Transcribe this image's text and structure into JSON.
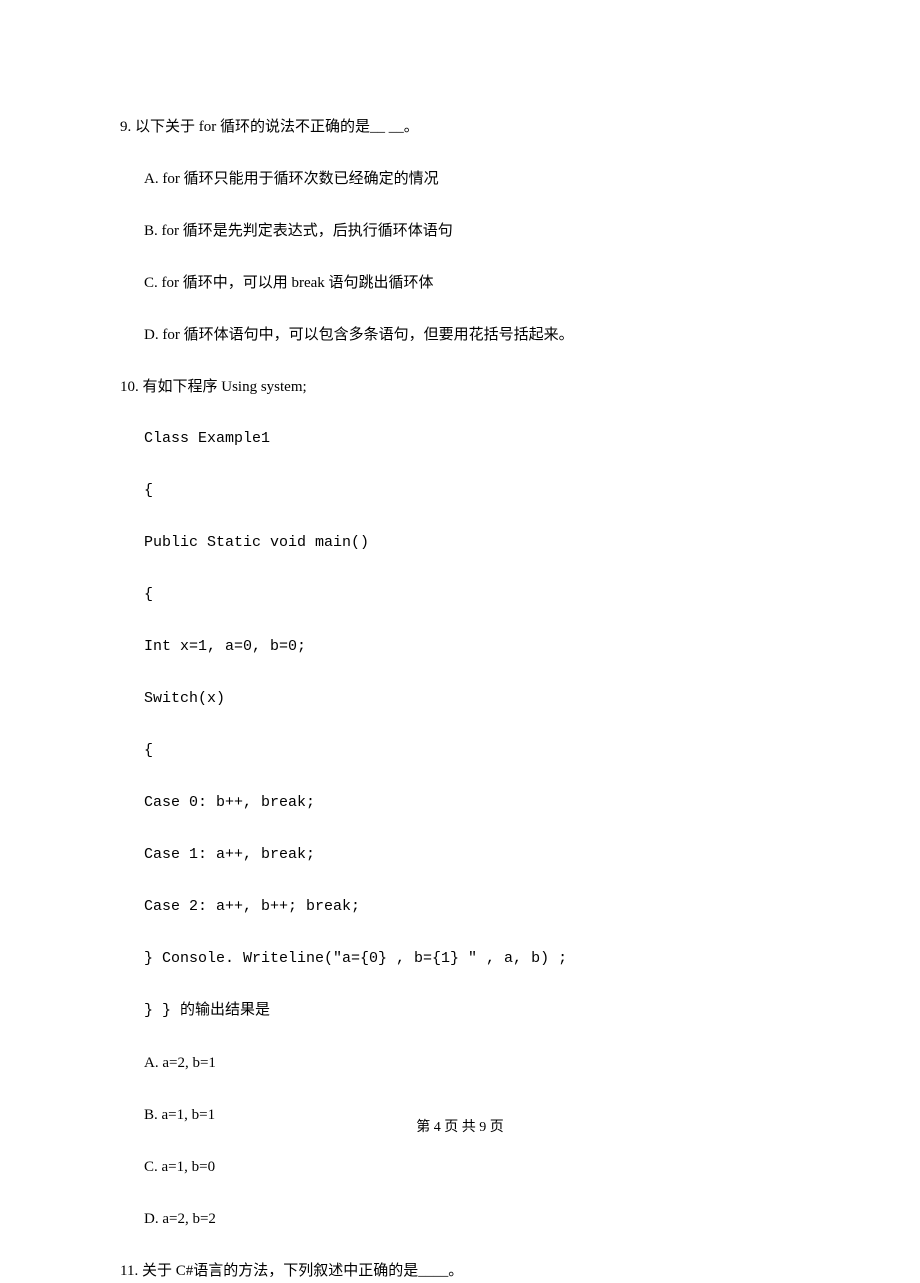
{
  "q9": {
    "stem": "9. 以下关于 for 循环的说法不正确的是__ __。",
    "options": {
      "a": "A. for 循环只能用于循环次数已经确定的情况",
      "b": "B. for 循环是先判定表达式，后执行循环体语句",
      "c": "C. for 循环中，可以用 break 语句跳出循环体",
      "d": "D. for 循环体语句中，可以包含多条语句，但要用花括号括起来。"
    }
  },
  "q10": {
    "stem": "10. 有如下程序 Using system;",
    "code": {
      "l1": "Class Example1",
      "l2": "{",
      "l3": "Public Static void main()",
      "l4": "{",
      "l5": "Int x=1, a=0, b=0;",
      "l6": "Switch(x)",
      "l7": "{",
      "l8": "Case 0: b++, break;",
      "l9": "Case 1: a++, break;",
      "l10": "Case 2: a++, b++; break;",
      "l11": "} Console. Writeline(\"a={0} , b={1} \" , a, b) ;",
      "l12": "} } 的输出结果是"
    },
    "options": {
      "a": "A. a=2, b=1",
      "b": "B. a=1, b=1",
      "c": "C. a=1, b=0",
      "d": "D. a=2, b=2"
    }
  },
  "q11": {
    "stem": "11. 关于 C#语言的方法，下列叙述中正确的是____。"
  },
  "footer": "第 4 页 共 9 页"
}
